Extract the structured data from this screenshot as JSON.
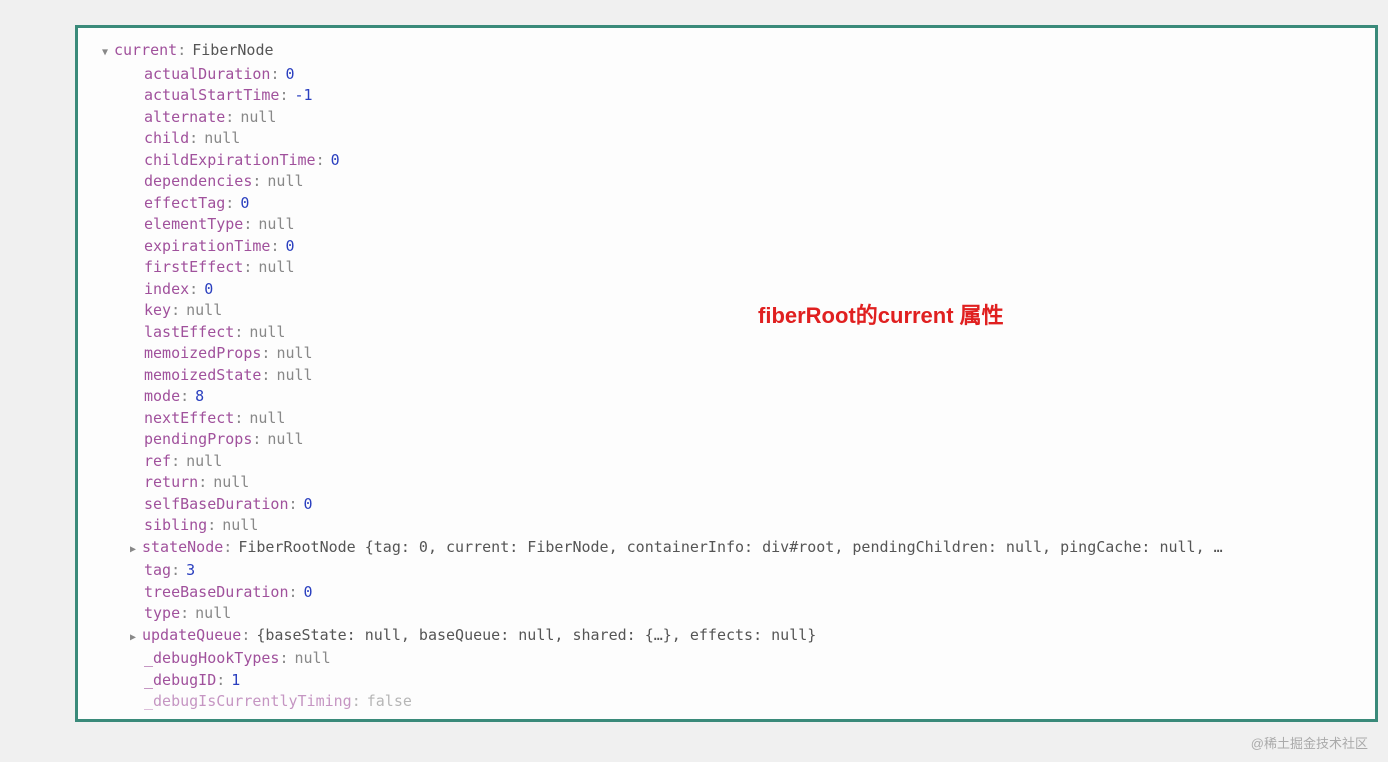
{
  "root": {
    "key": "current",
    "value": "FiberNode"
  },
  "props": [
    {
      "key": "actualDuration",
      "value": "0",
      "type": "number"
    },
    {
      "key": "actualStartTime",
      "value": "-1",
      "type": "number"
    },
    {
      "key": "alternate",
      "value": "null",
      "type": "null"
    },
    {
      "key": "child",
      "value": "null",
      "type": "null"
    },
    {
      "key": "childExpirationTime",
      "value": "0",
      "type": "number"
    },
    {
      "key": "dependencies",
      "value": "null",
      "type": "null"
    },
    {
      "key": "effectTag",
      "value": "0",
      "type": "number"
    },
    {
      "key": "elementType",
      "value": "null",
      "type": "null"
    },
    {
      "key": "expirationTime",
      "value": "0",
      "type": "number"
    },
    {
      "key": "firstEffect",
      "value": "null",
      "type": "null"
    },
    {
      "key": "index",
      "value": "0",
      "type": "number"
    },
    {
      "key": "key",
      "value": "null",
      "type": "null"
    },
    {
      "key": "lastEffect",
      "value": "null",
      "type": "null"
    },
    {
      "key": "memoizedProps",
      "value": "null",
      "type": "null"
    },
    {
      "key": "memoizedState",
      "value": "null",
      "type": "null"
    },
    {
      "key": "mode",
      "value": "8",
      "type": "number"
    },
    {
      "key": "nextEffect",
      "value": "null",
      "type": "null"
    },
    {
      "key": "pendingProps",
      "value": "null",
      "type": "null"
    },
    {
      "key": "ref",
      "value": "null",
      "type": "null"
    },
    {
      "key": "return",
      "value": "null",
      "type": "null"
    },
    {
      "key": "selfBaseDuration",
      "value": "0",
      "type": "number"
    },
    {
      "key": "sibling",
      "value": "null",
      "type": "null"
    }
  ],
  "stateNode": {
    "key": "stateNode",
    "value": "FiberRootNode {tag: 0, current: FiberNode, containerInfo: div#root, pendingChildren: null, pingCache: null, …"
  },
  "props2": [
    {
      "key": "tag",
      "value": "3",
      "type": "number"
    },
    {
      "key": "treeBaseDuration",
      "value": "0",
      "type": "number"
    },
    {
      "key": "type",
      "value": "null",
      "type": "null"
    }
  ],
  "updateQueue": {
    "key": "updateQueue",
    "value": "{baseState: null, baseQueue: null, shared: {…}, effects: null}"
  },
  "props3": [
    {
      "key": "_debugHookTypes",
      "value": "null",
      "type": "null"
    },
    {
      "key": "_debugID",
      "value": "1",
      "type": "number"
    }
  ],
  "partial": {
    "key": "_debugIsCurrentlyTiming",
    "value": "false"
  },
  "annotation": "fiberRoot的current 属性",
  "watermark": "@稀土掘金技术社区"
}
